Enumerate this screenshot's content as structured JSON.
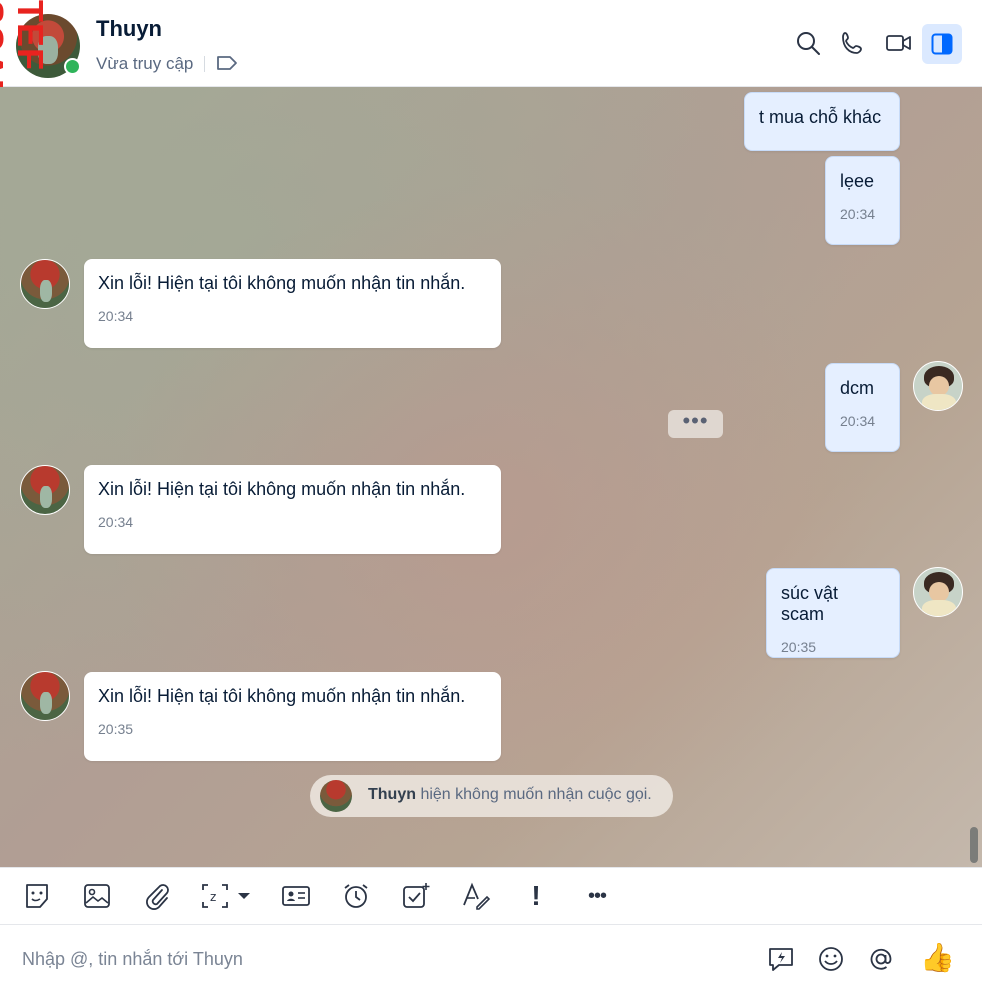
{
  "header": {
    "name": "Thuyn",
    "status": "Vừa truy cập",
    "watermark": "TEF SCAM.INFO"
  },
  "messages": [
    {
      "side": "out",
      "text": "t mua chỗ khác",
      "time": ""
    },
    {
      "side": "out",
      "text": "lẹee",
      "time": "20:34"
    },
    {
      "side": "in",
      "text": "Xin lỗi! Hiện tại tôi không muốn nhận tin nhắn.",
      "time": "20:34"
    },
    {
      "side": "out",
      "text": "dcm",
      "time": "20:34"
    },
    {
      "side": "in",
      "text": "Xin lỗi! Hiện tại tôi không muốn nhận tin nhắn.",
      "time": "20:34"
    },
    {
      "side": "out",
      "text": "súc vật scam",
      "time": "20:35"
    },
    {
      "side": "in",
      "text": "Xin lỗi! Hiện tại tôi không muốn nhận tin nhắn.",
      "time": "20:35"
    }
  ],
  "more_dots": "•••",
  "call_notice": {
    "name": "Thuyn",
    "text": "hiện không muốn nhận cuộc gọi."
  },
  "toolbar": {
    "icons": [
      "sticker-icon",
      "image-icon",
      "attachment-icon",
      "screenshot-icon",
      "contact-card-icon",
      "reminder-icon",
      "task-icon",
      "text-format-icon",
      "important-icon",
      "more-icon"
    ],
    "important_glyph": "!",
    "more_glyph": "•••"
  },
  "composer": {
    "placeholder": "Nhập @, tin nhắn tới Thuyn",
    "thumb": "👍"
  },
  "colors": {
    "accent": "#0068ff",
    "online": "#2fb45a",
    "bubble_out": "#e5efff"
  }
}
